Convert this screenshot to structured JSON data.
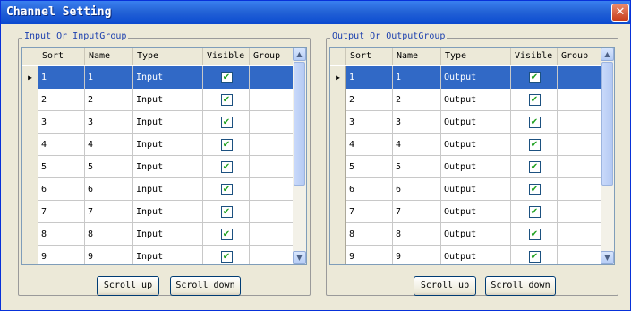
{
  "window": {
    "title": "Channel Setting"
  },
  "input_group": {
    "legend": "Input Or InputGroup",
    "columns": [
      "Sort",
      "Name",
      "Type",
      "Visible",
      "Group"
    ],
    "rows": [
      {
        "sort": "1",
        "name": "1",
        "type": "Input",
        "visible": true,
        "group": ""
      },
      {
        "sort": "2",
        "name": "2",
        "type": "Input",
        "visible": true,
        "group": ""
      },
      {
        "sort": "3",
        "name": "3",
        "type": "Input",
        "visible": true,
        "group": ""
      },
      {
        "sort": "4",
        "name": "4",
        "type": "Input",
        "visible": true,
        "group": ""
      },
      {
        "sort": "5",
        "name": "5",
        "type": "Input",
        "visible": true,
        "group": ""
      },
      {
        "sort": "6",
        "name": "6",
        "type": "Input",
        "visible": true,
        "group": ""
      },
      {
        "sort": "7",
        "name": "7",
        "type": "Input",
        "visible": true,
        "group": ""
      },
      {
        "sort": "8",
        "name": "8",
        "type": "Input",
        "visible": true,
        "group": ""
      },
      {
        "sort": "9",
        "name": "9",
        "type": "Input",
        "visible": true,
        "group": ""
      }
    ],
    "selected_row": 0,
    "scroll_up_label": "Scroll up",
    "scroll_down_label": "Scroll down"
  },
  "output_group": {
    "legend": "Output Or OutputGroup",
    "columns": [
      "Sort",
      "Name",
      "Type",
      "Visible",
      "Group"
    ],
    "rows": [
      {
        "sort": "1",
        "name": "1",
        "type": "Output",
        "visible": true,
        "group": ""
      },
      {
        "sort": "2",
        "name": "2",
        "type": "Output",
        "visible": true,
        "group": ""
      },
      {
        "sort": "3",
        "name": "3",
        "type": "Output",
        "visible": true,
        "group": ""
      },
      {
        "sort": "4",
        "name": "4",
        "type": "Output",
        "visible": true,
        "group": ""
      },
      {
        "sort": "5",
        "name": "5",
        "type": "Output",
        "visible": true,
        "group": ""
      },
      {
        "sort": "6",
        "name": "6",
        "type": "Output",
        "visible": true,
        "group": ""
      },
      {
        "sort": "7",
        "name": "7",
        "type": "Output",
        "visible": true,
        "group": ""
      },
      {
        "sort": "8",
        "name": "8",
        "type": "Output",
        "visible": true,
        "group": ""
      },
      {
        "sort": "9",
        "name": "9",
        "type": "Output",
        "visible": true,
        "group": ""
      }
    ],
    "selected_row": 0,
    "scroll_up_label": "Scroll up",
    "scroll_down_label": "Scroll down"
  },
  "icons": {
    "close": "close-icon",
    "row_pointer": "row-pointer-icon",
    "checkbox": "checkbox-checked-icon",
    "scroll_up": "scroll-up-arrow-icon",
    "scroll_down": "scroll-down-arrow-icon"
  },
  "colors": {
    "title_bar": "#2463d6",
    "selection": "#3169c6",
    "legend_text": "#1b3fae",
    "check_mark": "#21a121"
  }
}
